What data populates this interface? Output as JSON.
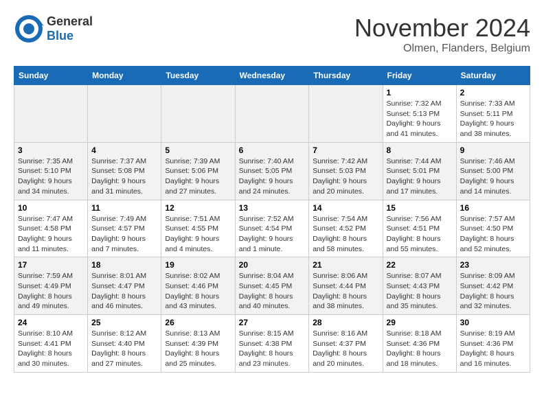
{
  "header": {
    "logo_line1": "General",
    "logo_line2": "Blue",
    "month_title": "November 2024",
    "location": "Olmen, Flanders, Belgium"
  },
  "days_of_week": [
    "Sunday",
    "Monday",
    "Tuesday",
    "Wednesday",
    "Thursday",
    "Friday",
    "Saturday"
  ],
  "weeks": [
    [
      {
        "day": "",
        "info": ""
      },
      {
        "day": "",
        "info": ""
      },
      {
        "day": "",
        "info": ""
      },
      {
        "day": "",
        "info": ""
      },
      {
        "day": "",
        "info": ""
      },
      {
        "day": "1",
        "info": "Sunrise: 7:32 AM\nSunset: 5:13 PM\nDaylight: 9 hours\nand 41 minutes."
      },
      {
        "day": "2",
        "info": "Sunrise: 7:33 AM\nSunset: 5:11 PM\nDaylight: 9 hours\nand 38 minutes."
      }
    ],
    [
      {
        "day": "3",
        "info": "Sunrise: 7:35 AM\nSunset: 5:10 PM\nDaylight: 9 hours\nand 34 minutes."
      },
      {
        "day": "4",
        "info": "Sunrise: 7:37 AM\nSunset: 5:08 PM\nDaylight: 9 hours\nand 31 minutes."
      },
      {
        "day": "5",
        "info": "Sunrise: 7:39 AM\nSunset: 5:06 PM\nDaylight: 9 hours\nand 27 minutes."
      },
      {
        "day": "6",
        "info": "Sunrise: 7:40 AM\nSunset: 5:05 PM\nDaylight: 9 hours\nand 24 minutes."
      },
      {
        "day": "7",
        "info": "Sunrise: 7:42 AM\nSunset: 5:03 PM\nDaylight: 9 hours\nand 20 minutes."
      },
      {
        "day": "8",
        "info": "Sunrise: 7:44 AM\nSunset: 5:01 PM\nDaylight: 9 hours\nand 17 minutes."
      },
      {
        "day": "9",
        "info": "Sunrise: 7:46 AM\nSunset: 5:00 PM\nDaylight: 9 hours\nand 14 minutes."
      }
    ],
    [
      {
        "day": "10",
        "info": "Sunrise: 7:47 AM\nSunset: 4:58 PM\nDaylight: 9 hours\nand 11 minutes."
      },
      {
        "day": "11",
        "info": "Sunrise: 7:49 AM\nSunset: 4:57 PM\nDaylight: 9 hours\nand 7 minutes."
      },
      {
        "day": "12",
        "info": "Sunrise: 7:51 AM\nSunset: 4:55 PM\nDaylight: 9 hours\nand 4 minutes."
      },
      {
        "day": "13",
        "info": "Sunrise: 7:52 AM\nSunset: 4:54 PM\nDaylight: 9 hours\nand 1 minute."
      },
      {
        "day": "14",
        "info": "Sunrise: 7:54 AM\nSunset: 4:52 PM\nDaylight: 8 hours\nand 58 minutes."
      },
      {
        "day": "15",
        "info": "Sunrise: 7:56 AM\nSunset: 4:51 PM\nDaylight: 8 hours\nand 55 minutes."
      },
      {
        "day": "16",
        "info": "Sunrise: 7:57 AM\nSunset: 4:50 PM\nDaylight: 8 hours\nand 52 minutes."
      }
    ],
    [
      {
        "day": "17",
        "info": "Sunrise: 7:59 AM\nSunset: 4:49 PM\nDaylight: 8 hours\nand 49 minutes."
      },
      {
        "day": "18",
        "info": "Sunrise: 8:01 AM\nSunset: 4:47 PM\nDaylight: 8 hours\nand 46 minutes."
      },
      {
        "day": "19",
        "info": "Sunrise: 8:02 AM\nSunset: 4:46 PM\nDaylight: 8 hours\nand 43 minutes."
      },
      {
        "day": "20",
        "info": "Sunrise: 8:04 AM\nSunset: 4:45 PM\nDaylight: 8 hours\nand 40 minutes."
      },
      {
        "day": "21",
        "info": "Sunrise: 8:06 AM\nSunset: 4:44 PM\nDaylight: 8 hours\nand 38 minutes."
      },
      {
        "day": "22",
        "info": "Sunrise: 8:07 AM\nSunset: 4:43 PM\nDaylight: 8 hours\nand 35 minutes."
      },
      {
        "day": "23",
        "info": "Sunrise: 8:09 AM\nSunset: 4:42 PM\nDaylight: 8 hours\nand 32 minutes."
      }
    ],
    [
      {
        "day": "24",
        "info": "Sunrise: 8:10 AM\nSunset: 4:41 PM\nDaylight: 8 hours\nand 30 minutes."
      },
      {
        "day": "25",
        "info": "Sunrise: 8:12 AM\nSunset: 4:40 PM\nDaylight: 8 hours\nand 27 minutes."
      },
      {
        "day": "26",
        "info": "Sunrise: 8:13 AM\nSunset: 4:39 PM\nDaylight: 8 hours\nand 25 minutes."
      },
      {
        "day": "27",
        "info": "Sunrise: 8:15 AM\nSunset: 4:38 PM\nDaylight: 8 hours\nand 23 minutes."
      },
      {
        "day": "28",
        "info": "Sunrise: 8:16 AM\nSunset: 4:37 PM\nDaylight: 8 hours\nand 20 minutes."
      },
      {
        "day": "29",
        "info": "Sunrise: 8:18 AM\nSunset: 4:36 PM\nDaylight: 8 hours\nand 18 minutes."
      },
      {
        "day": "30",
        "info": "Sunrise: 8:19 AM\nSunset: 4:36 PM\nDaylight: 8 hours\nand 16 minutes."
      }
    ]
  ]
}
